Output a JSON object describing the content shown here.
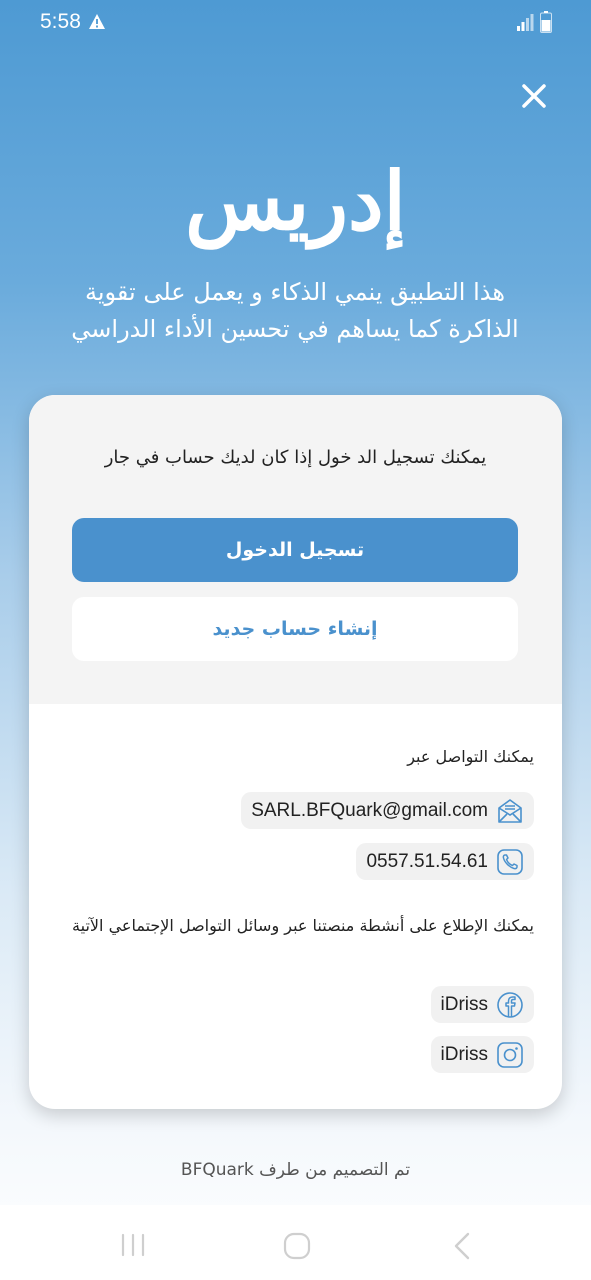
{
  "status_bar": {
    "time": "5:58",
    "icons": [
      "warning-icon",
      "signal-icon",
      "battery-icon"
    ]
  },
  "header": {
    "close_icon": "close-icon",
    "title": "إدريس",
    "subtitle": "هذا التطبيق ينمي الذكاء و يعمل على تقوية الذاكرة كما يساهم في تحسين الأداء الدراسي"
  },
  "auth": {
    "prompt": "يمكنك تسجيل الد خول إذا كان لديك حساب في جار",
    "login_label": "تسجيل الدخول",
    "register_label": "إنشاء حساب جديد"
  },
  "contact": {
    "heading": "يمكنك التواصل عبر",
    "email": "SARL.BFQuark@gmail.com",
    "phone": "0557.51.54.61",
    "email_icon": "mail-icon",
    "phone_icon": "phone-icon"
  },
  "social": {
    "heading": "يمكنك الإطلاع على أنشطة منصتنا عبر وسائل التواصل الإجتماعي الآتية",
    "facebook": "iDriss",
    "instagram": "iDriss",
    "facebook_icon": "facebook-icon",
    "instagram_icon": "instagram-icon"
  },
  "footer": {
    "credit": "تم التصميم من طرف BFQuark"
  },
  "nav": {
    "icons": [
      "recent-apps-icon",
      "home-icon",
      "back-icon"
    ]
  },
  "colors": {
    "primary": "#4a91cd",
    "background_top": "#4e9ad3",
    "card_top": "#f4f4f4",
    "pill": "#f1f1f1"
  }
}
